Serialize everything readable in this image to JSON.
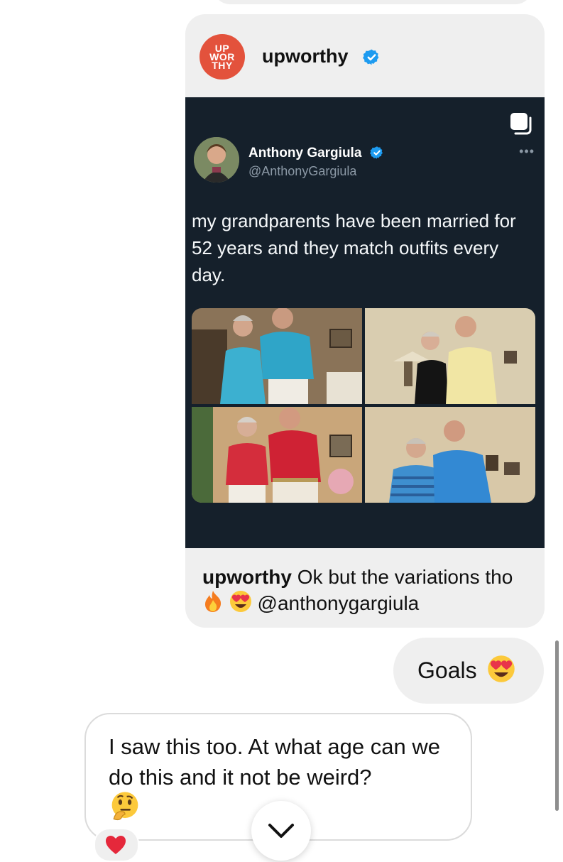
{
  "shared_post": {
    "logo_lines": [
      "UP",
      "WOR",
      "THY"
    ],
    "account_name": "upworthy",
    "tweet": {
      "author_name": "Anthony Gargiula",
      "author_handle": "@AnthonyGargiula",
      "more": "•••",
      "text": "my grandparents have been married for 52 years and they match outfits every day."
    },
    "caption": {
      "user": "upworthy",
      "text_part1": " Ok but the variations tho",
      "mention": " @anthonygargiula"
    }
  },
  "messages": {
    "outgoing": {
      "text": "Goals"
    },
    "incoming": {
      "text": "I saw this too.  At what age can we do this and it not be weird?"
    }
  },
  "colors": {
    "bubble_gray": "#efefef",
    "upworthy_red": "#e3523c",
    "twitter_bg": "#15202b",
    "verified_blue": "#1d9bf0"
  },
  "icons": {
    "verified": "verified-badge-icon",
    "multi_photo": "carousel-icon",
    "fire": "fire-emoji",
    "heart_eyes": "heart-eyes-emoji",
    "thinking": "thinking-face-emoji",
    "heart_reaction": "red-heart-emoji",
    "scroll_down": "chevron-down-icon"
  }
}
